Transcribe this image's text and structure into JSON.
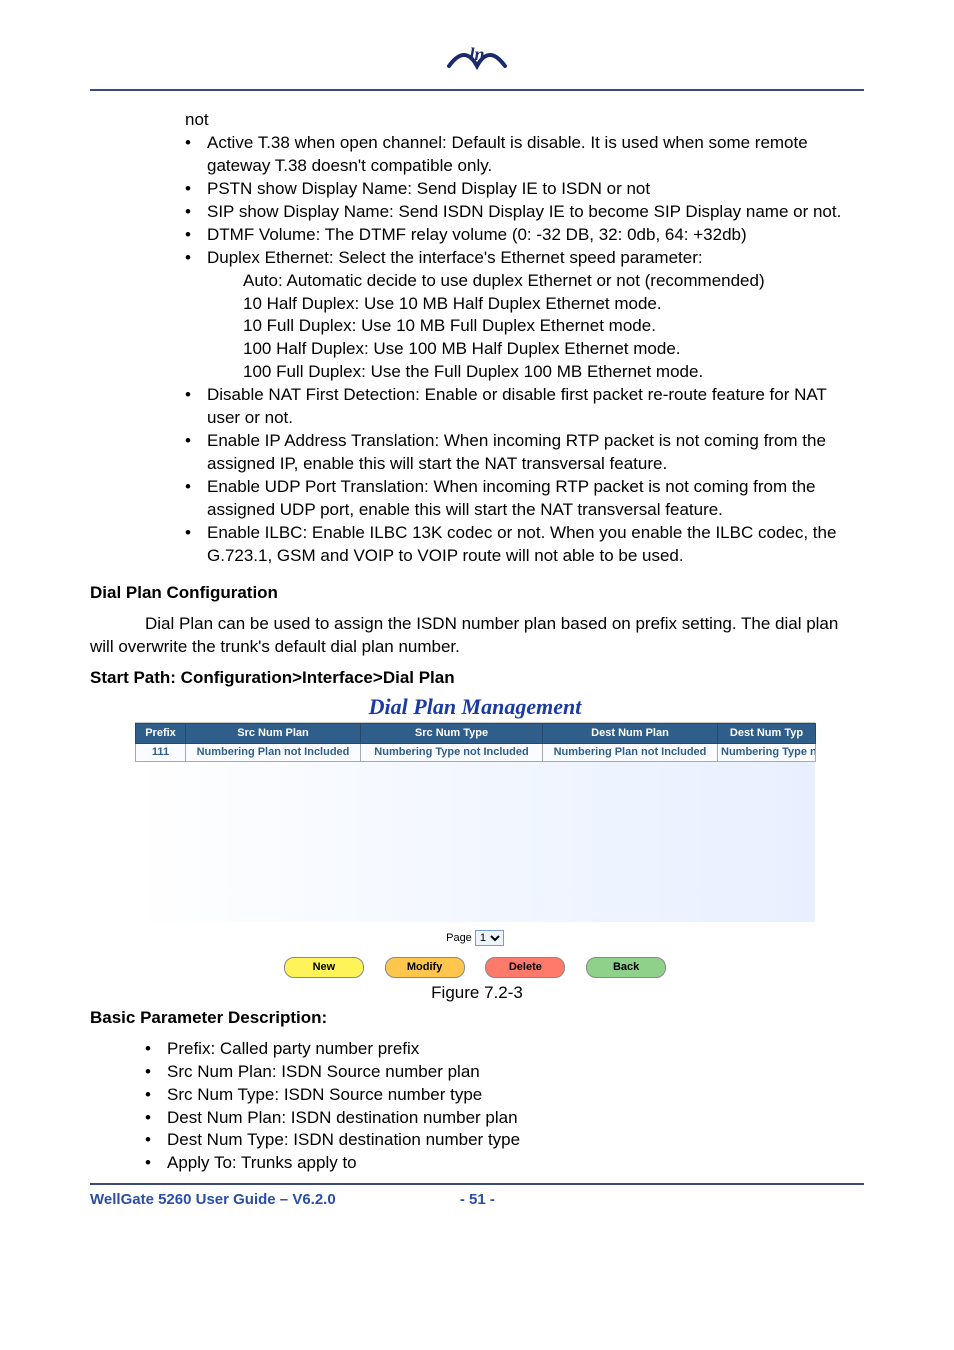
{
  "body": {
    "lead_in_tail": "not",
    "bullets": [
      {
        "text": "Active T.38 when open channel: Default is disable. It is used when some remote gateway T.38 doesn't compatible only."
      },
      {
        "text": "PSTN show Display Name: Send Display IE to  ISDN or not"
      },
      {
        "text": "SIP show Display Name: Send ISDN Display IE to become SIP Display name or not."
      },
      {
        "text": "DTMF Volume: The DTMF relay volume (0: -32 DB, 32: 0db, 64: +32db)"
      },
      {
        "text": "Duplex Ethernet: Select the interface's Ethernet speed parameter:",
        "sublines": [
          "Auto: Automatic decide to use duplex Ethernet or not (recommended)",
          "10 Half Duplex: Use 10 MB Half Duplex Ethernet mode.",
          "10 Full Duplex: Use 10 MB Full Duplex Ethernet mode.",
          "100 Half Duplex: Use 100 MB Half Duplex Ethernet mode.",
          "100 Full Duplex: Use the Full Duplex 100 MB Ethernet mode."
        ]
      },
      {
        "text": "Disable NAT First Detection: Enable or disable first packet re-route feature for NAT user or not."
      },
      {
        "text": "Enable IP Address Translation: When incoming RTP packet is not coming from the assigned IP, enable this will start the NAT transversal feature."
      },
      {
        "text": "Enable UDP Port Translation: When incoming RTP packet is not coming from the assigned UDP port, enable this will start the NAT transversal feature."
      },
      {
        "text": "Enable ILBC: Enable ILBC 13K codec or not. When you enable the ILBC codec, the G.723.1, GSM and VOIP to VOIP route will not able to be used."
      }
    ],
    "dial_plan_heading": "Dial Plan Configuration",
    "dial_plan_desc": "Dial Plan can be used to assign the ISDN number plan based on prefix setting. The dial plan will overwrite the trunk's default dial plan number.",
    "start_path": "Start Path: Configuration>Interface>Dial Plan",
    "figure_caption": "Figure 7.2-3",
    "bpd_heading": "Basic Parameter Description:",
    "bpd_items": [
      "Prefix: Called party number prefix",
      "Src Num Plan: ISDN Source number plan",
      "Src Num Type: ISDN Source number type",
      "Dest Num Plan: ISDN destination number plan",
      "Dest Num Type: ISDN destination number type",
      "Apply To: Trunks apply to"
    ]
  },
  "dialplan": {
    "title": "Dial Plan Management",
    "headers": [
      "Prefix",
      "Src Num Plan",
      "Src Num Type",
      "Dest Num Plan",
      "Dest Num Typ"
    ],
    "row": {
      "prefix": "111",
      "src_plan": "Numbering Plan not Included",
      "src_type": "Numbering Type not Included",
      "dest_plan": "Numbering Plan not Included",
      "dest_type": "Numbering Type not I"
    },
    "pager_label": "Page",
    "pager_value": "1",
    "buttons": {
      "new": "New",
      "modify": "Modify",
      "delete": "Delete",
      "back": "Back"
    }
  },
  "footer": {
    "doc": "WellGate 5260 User Guide – V6.2.0",
    "page": "- 51 -"
  }
}
